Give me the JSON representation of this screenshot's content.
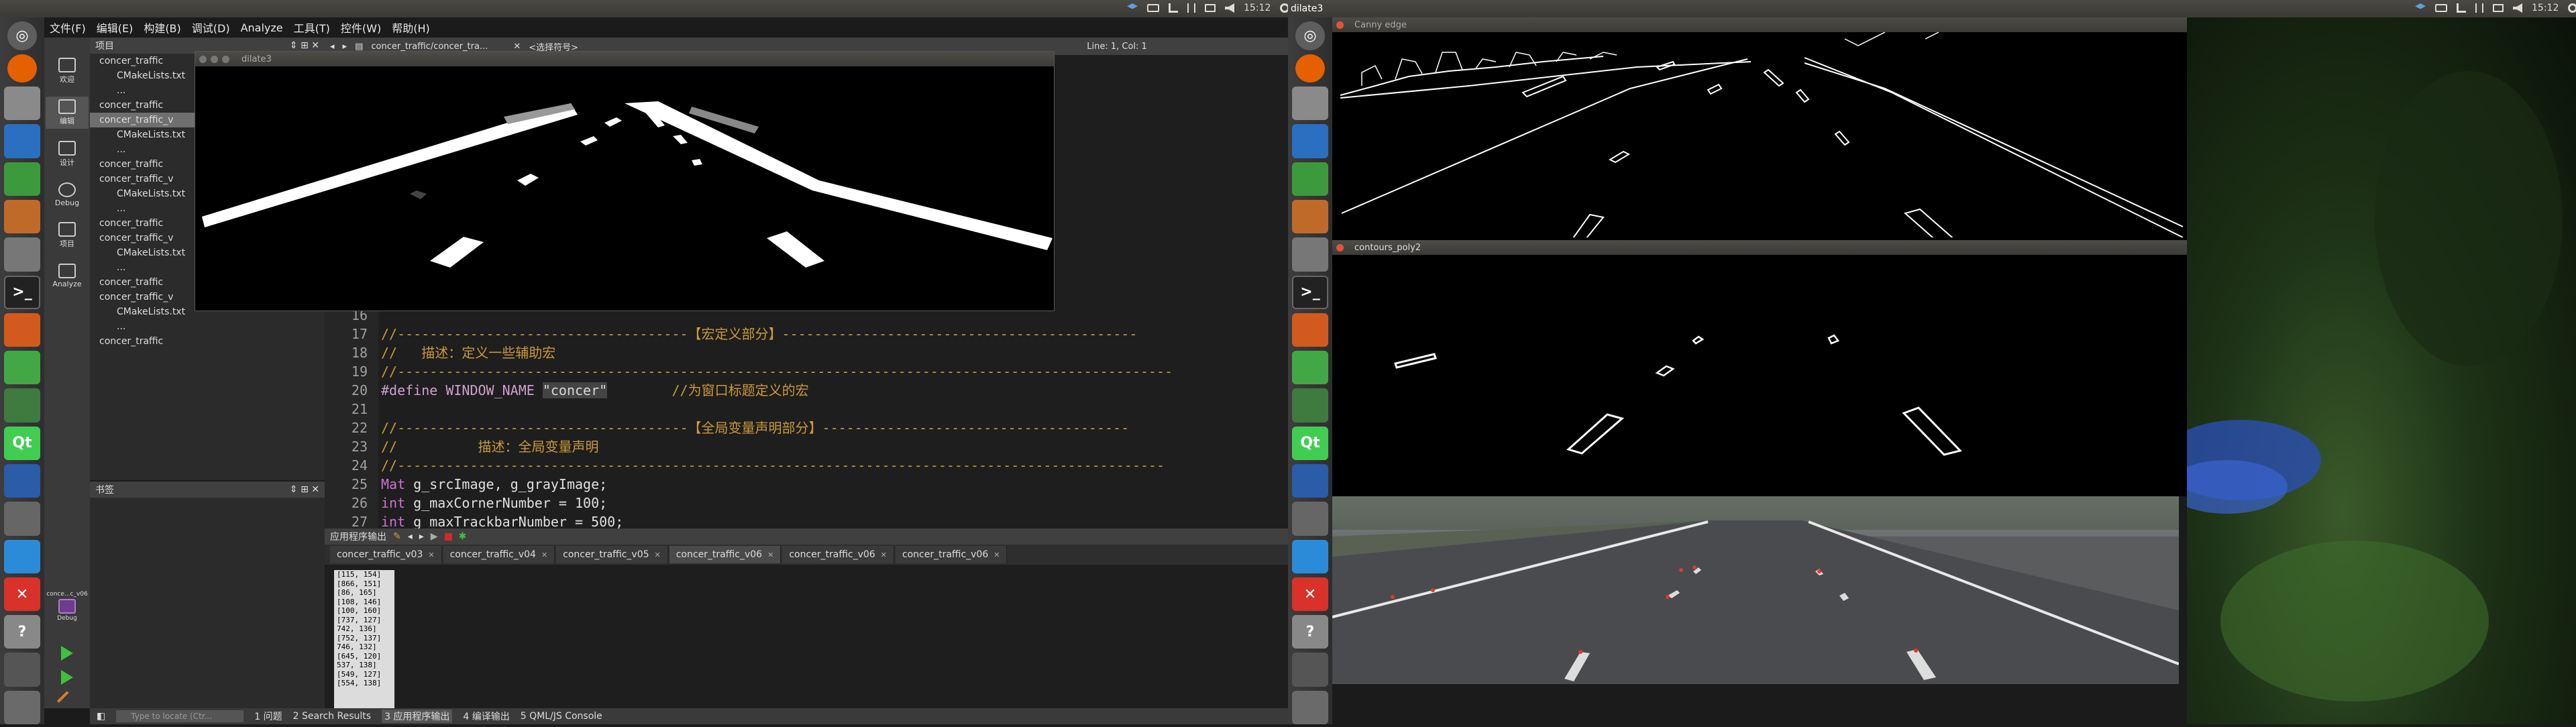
{
  "left_topbar": {
    "time": "15:12",
    "tray_icons": [
      "dropbox-icon",
      "keyboard-icon",
      "network-icon",
      "transfer-icon",
      "mail-icon",
      "volume-icon"
    ]
  },
  "right_topbar": {
    "title": "dilate3",
    "time": "15:12",
    "tray_icons": [
      "dropbox-icon",
      "keyboard-icon",
      "network-icon",
      "transfer-icon",
      "mail-icon",
      "volume-icon"
    ]
  },
  "launcher_items": [
    "ubuntu-home-icon",
    "firefox-icon",
    "files-icon",
    "writer-icon",
    "calc-icon",
    "impress-icon",
    "settings-icon",
    "terminal-icon",
    "matlab-icon",
    "qt-creator-icon",
    "image-viewer-icon",
    "qt-icon",
    "remote-icon",
    "disk-utility-icon",
    "qt-designer-icon",
    "xmind-icon",
    "help-icon",
    "storage-icon",
    "trash-icon"
  ],
  "menu": [
    "文件(F)",
    "编辑(E)",
    "构建(B)",
    "调试(D)",
    "Analyze",
    "工具(T)",
    "控件(W)",
    "帮助(H)"
  ],
  "modes": [
    {
      "label": "欢迎",
      "icon": "welcome-icon"
    },
    {
      "label": "编辑",
      "icon": "edit-icon"
    },
    {
      "label": "设计",
      "icon": "design-icon"
    },
    {
      "label": "Debug",
      "icon": "debug-icon"
    },
    {
      "label": "项目",
      "icon": "projects-icon"
    },
    {
      "label": "Analyze",
      "icon": "analyze-icon"
    }
  ],
  "project_panel": {
    "title": "项目",
    "items": [
      "concer_traffic",
      "CMakeLists.txt",
      "...",
      "concer_traffic",
      "concer_traffic_v",
      "CMakeLists.txt",
      "...",
      "concer_traffic",
      "concer_traffic_v",
      "CMakeLists.txt",
      "...",
      "concer_traffic",
      "concer_traffic_v",
      "CMakeLists.txt",
      "...",
      "concer_traffic",
      "concer_traffic_v",
      "CMakeLists.txt",
      "...",
      "concer_traffic"
    ]
  },
  "bookmarks_title": "书签",
  "kit": {
    "name": "conce...c_v06",
    "build": "Debug"
  },
  "editor_toolbar": {
    "file": "concer_traffic/concer_tra...",
    "symbol": "<选择符号>",
    "position": "Line: 1, Col: 1"
  },
  "code_lines": [
    {
      "n": "16",
      "parts": [
        {
          "c": "plain",
          "t": ""
        }
      ]
    },
    {
      "n": "17",
      "parts": [
        {
          "c": "cm",
          "t": "//------------------------------------【宏定义部分】--------------------------------------------"
        }
      ]
    },
    {
      "n": "18",
      "parts": [
        {
          "c": "cm",
          "t": "//   描述：定义一些辅助宏"
        }
      ]
    },
    {
      "n": "19",
      "parts": [
        {
          "c": "cm",
          "t": "//------------------------------------------------------------------------------------------------"
        }
      ]
    },
    {
      "n": "20",
      "parts": [
        {
          "c": "df",
          "t": "#define WINDOW_NAME "
        },
        {
          "c": "str",
          "t": "\"concer\""
        },
        {
          "c": "cm",
          "t": "        //为窗口标题定义的宏"
        }
      ]
    },
    {
      "n": "21",
      "parts": [
        {
          "c": "plain",
          "t": ""
        }
      ]
    },
    {
      "n": "22",
      "parts": [
        {
          "c": "cm",
          "t": "//------------------------------------【全局变量声明部分】--------------------------------------"
        }
      ]
    },
    {
      "n": "23",
      "parts": [
        {
          "c": "cm",
          "t": "//          描述：全局变量声明"
        }
      ]
    },
    {
      "n": "24",
      "parts": [
        {
          "c": "cm",
          "t": "//-----------------------------------------------------------------------------------------------"
        }
      ]
    },
    {
      "n": "25",
      "parts": [
        {
          "c": "kw",
          "t": "Mat"
        },
        {
          "c": "plain",
          "t": " g_srcImage, g_grayImage;"
        }
      ]
    },
    {
      "n": "26",
      "parts": [
        {
          "c": "kw",
          "t": "int"
        },
        {
          "c": "plain",
          "t": " g_maxCornerNumber = 100;"
        }
      ]
    },
    {
      "n": "27",
      "parts": [
        {
          "c": "kw",
          "t": "int"
        },
        {
          "c": "plain",
          "t": " g_maxTrackbarNumber = 500;"
        }
      ]
    }
  ],
  "output": {
    "title": "应用程序输出",
    "tabs": [
      "concer_traffic_v03",
      "concer_traffic_v04",
      "concer_traffic_v05",
      "concer_traffic_v06",
      "concer_traffic_v06",
      "concer_traffic_v06"
    ],
    "active_tab": 3,
    "lines": [
      "[115, 154]",
      "[866, 151]",
      "[86, 165]",
      "[108, 146]",
      "[100, 160]",
      "[737, 127]",
      "742, 136]",
      "[752, 137]",
      "746, 132]",
      "[645, 120]",
      "537, 138]",
      "[549, 127]",
      "[554, 138]"
    ]
  },
  "statusbar": {
    "locate_placeholder": "Type to locate (Ctr...",
    "items": [
      "1 问题",
      "2 Search Results",
      "3 应用程序输出",
      "4 编译输出",
      "5 QML/JS Console"
    ]
  },
  "windows": {
    "dilate": "dilate3",
    "canny": "Canny edge",
    "contours": "contours_poly2"
  }
}
